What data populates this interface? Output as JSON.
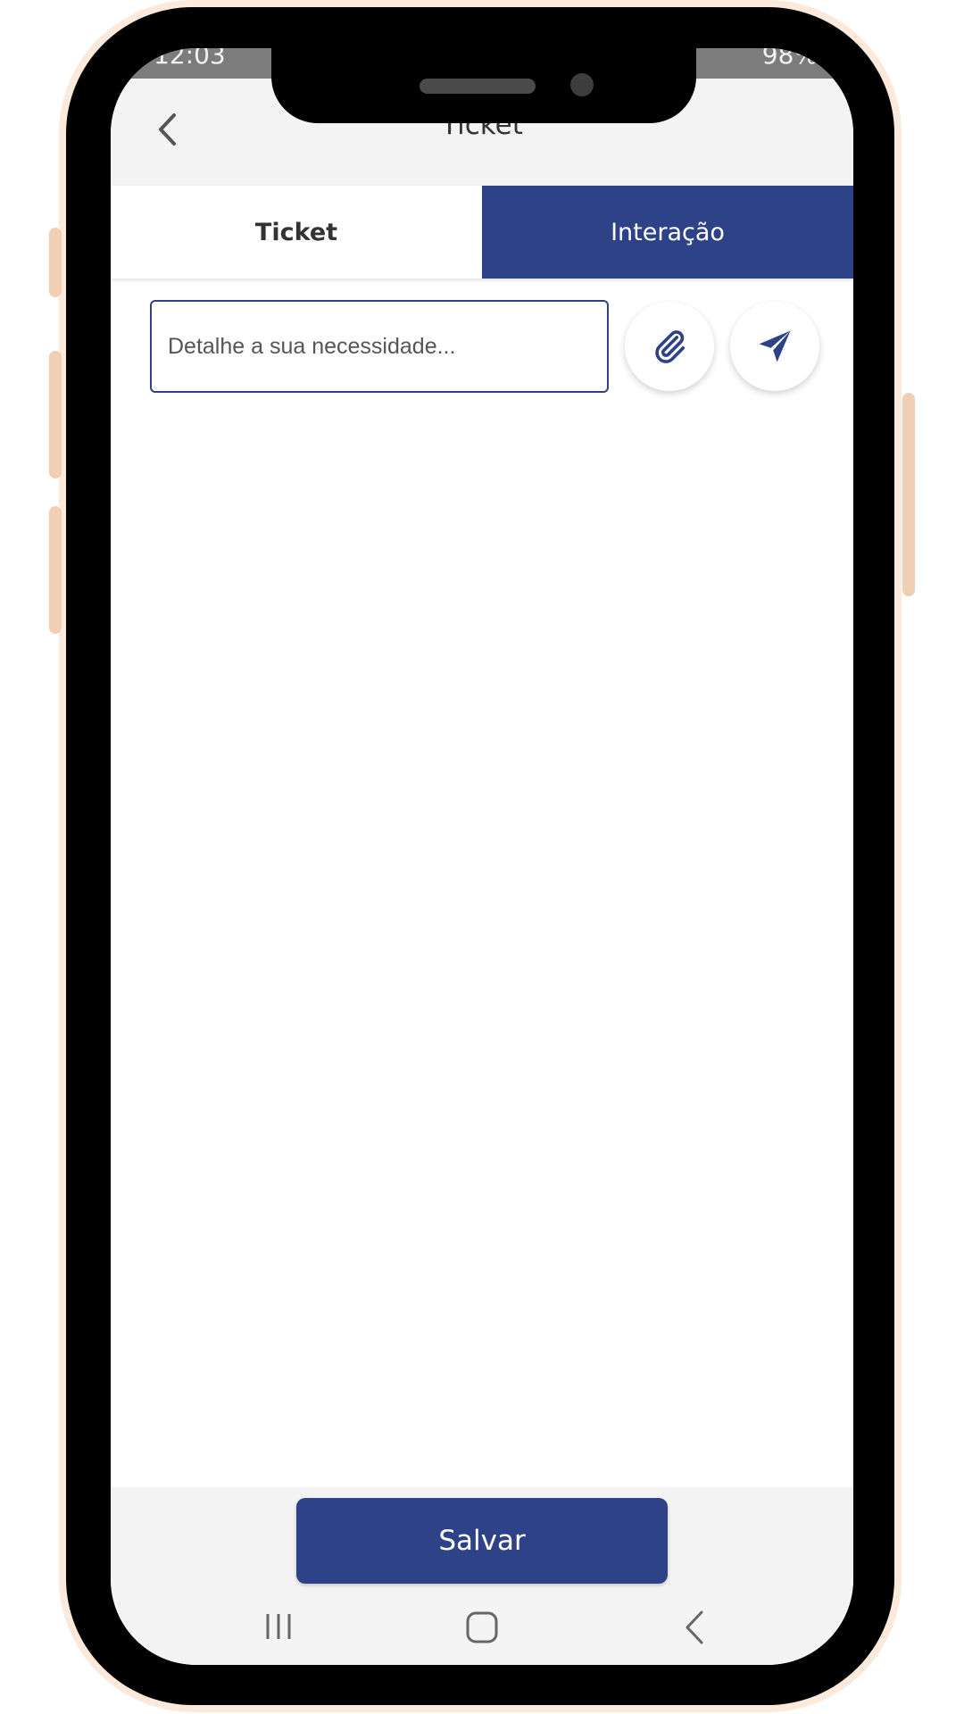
{
  "status_bar": {
    "time": "12:03",
    "battery": "98%"
  },
  "app_bar": {
    "title": "Ticket"
  },
  "tabs": [
    {
      "label": "Ticket",
      "active": false
    },
    {
      "label": "Interação",
      "active": true
    }
  ],
  "message_input": {
    "placeholder": "Detalhe a sua necessidade..."
  },
  "icons": {
    "back": "chevron-left",
    "attach": "paperclip",
    "send": "paper-plane",
    "nav_recents": "recents-lines",
    "nav_home": "home-square",
    "nav_back": "chevron-left"
  },
  "footer": {
    "save_label": "Salvar"
  },
  "colors": {
    "primary": "#2e4288",
    "frame": "#fbe9db",
    "app_bar_bg": "#f3f3f3"
  }
}
